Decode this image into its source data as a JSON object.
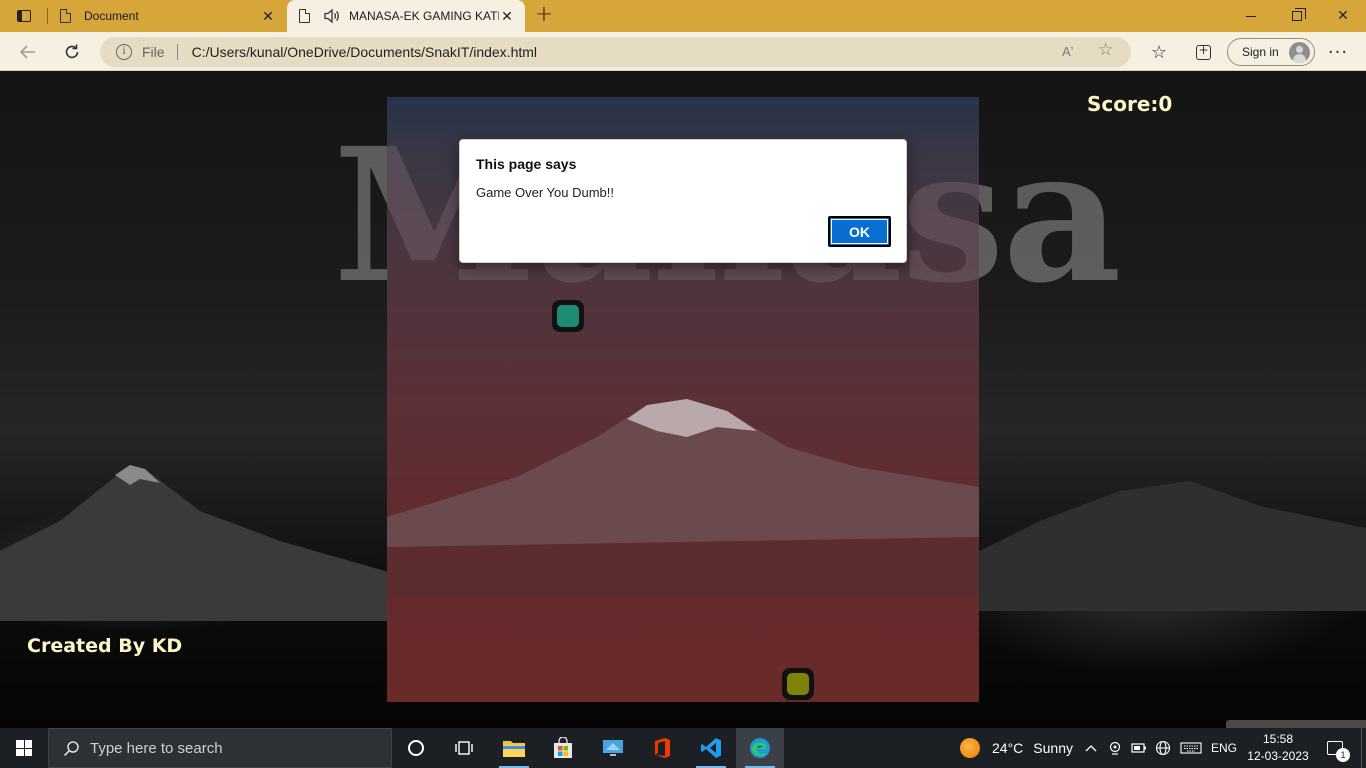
{
  "browser": {
    "tabs": [
      {
        "title": "Document",
        "active": false
      },
      {
        "title": "MANASA-EK GAMING KATH",
        "active": true,
        "playing_audio": true
      }
    ],
    "address": {
      "scheme_label": "File",
      "url": "C:/Users/kunal/OneDrive/Documents/SnakIT/index.html"
    },
    "toolbar": {
      "signin_label": "Sign in",
      "readaloud_glyph": "Aʼ",
      "addfav_glyph": "☆",
      "favorites_glyph": "☆",
      "more_glyph": "···"
    }
  },
  "page": {
    "watermark": "Manasa",
    "score_label": "Score:0",
    "credit": "Created By KD"
  },
  "alert": {
    "title": "This page says",
    "message": "Game Over You Dumb!!",
    "ok_label": "OK"
  },
  "colors": {
    "titlebar": "#d6a63a",
    "snake_head": "#1f8b73",
    "food": "#7f8208",
    "ok_button": "#0a6ed1"
  },
  "taskbar": {
    "search_placeholder": "Type here to search",
    "weather_temp": "24°C",
    "weather_condition": "Sunny",
    "language": "ENG",
    "time": "15:58",
    "date": "12-03-2023",
    "notification_count": "1",
    "pinned_apps": [
      "cortana",
      "task-view",
      "file-explorer",
      "microsoft-store",
      "remote-desktop",
      "office",
      "vscode",
      "edge"
    ]
  }
}
